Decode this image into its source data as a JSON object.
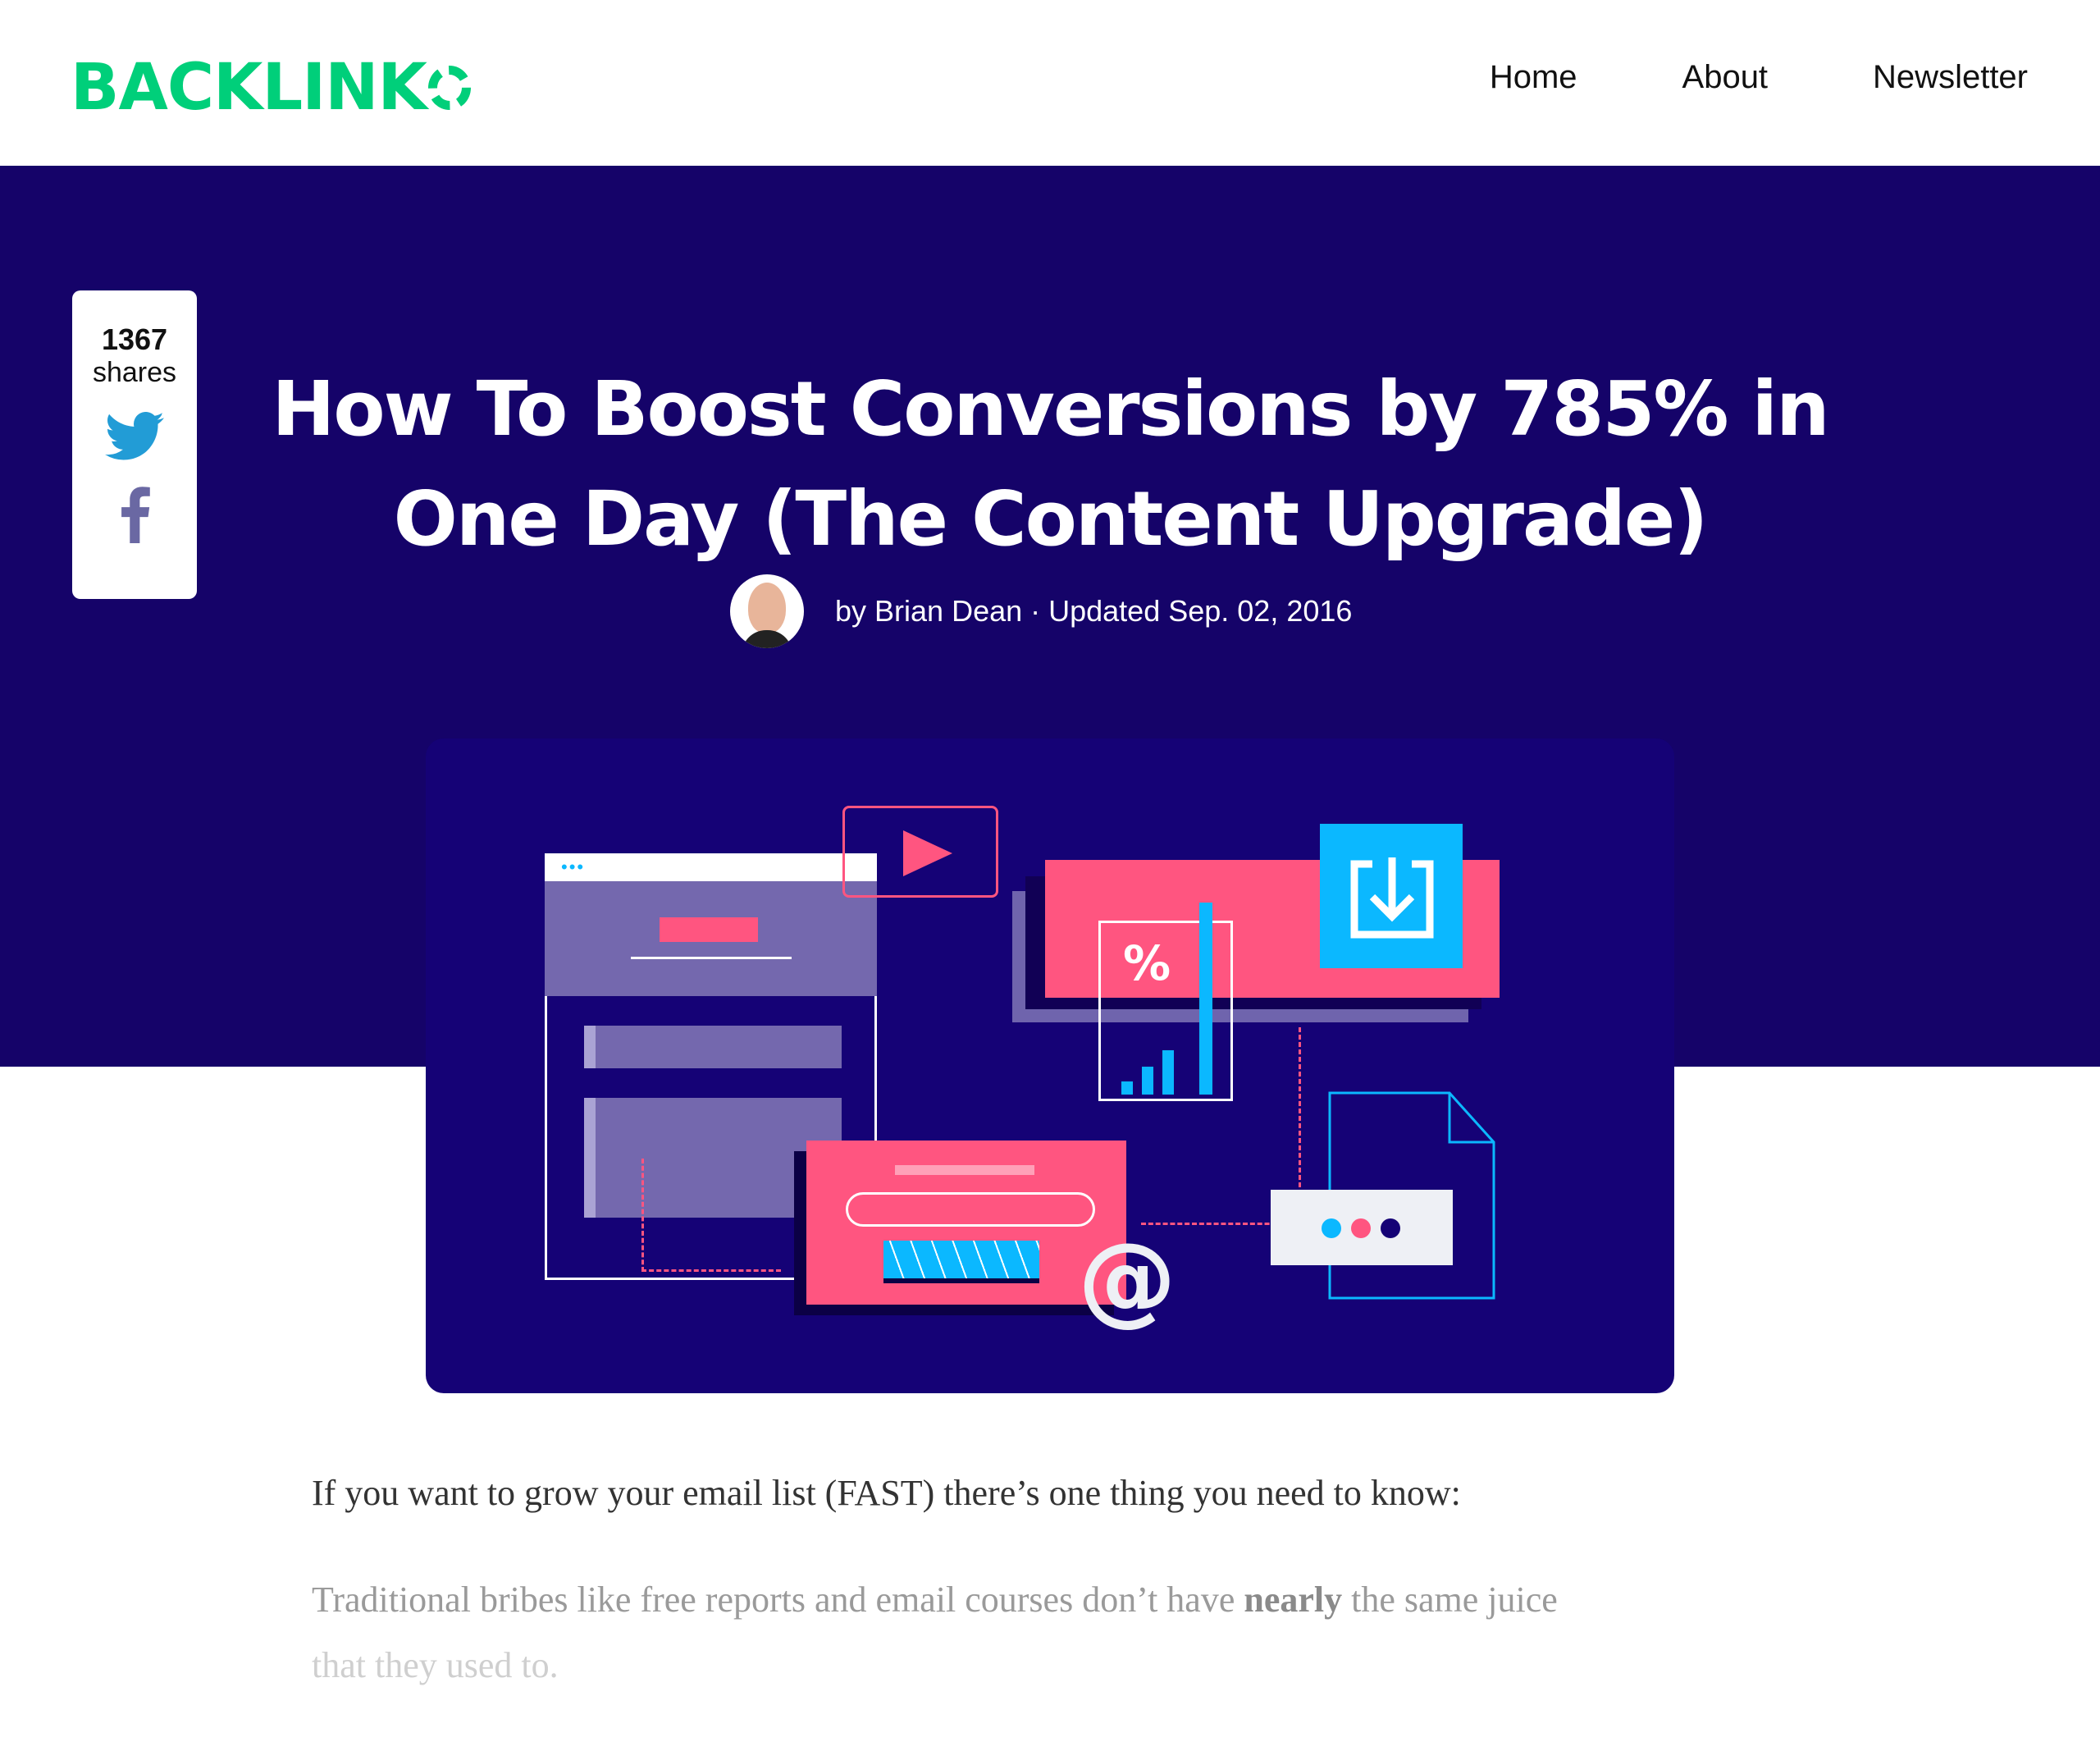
{
  "header": {
    "logo_text": "BACKLINK",
    "nav": [
      {
        "label": "Home"
      },
      {
        "label": "About"
      },
      {
        "label": "Newsletter"
      }
    ]
  },
  "share": {
    "count": "1367",
    "label": "shares",
    "icons": [
      "twitter-icon",
      "facebook-icon"
    ]
  },
  "article": {
    "title": "How To Boost Conversions by 785% in One Day (The Content Upgrade)",
    "byline": "by Brian Dean · Updated Sep. 02, 2016",
    "hero_image_icons": [
      "play-icon",
      "percent-icon",
      "download-icon",
      "at-icon",
      "document-icon"
    ],
    "percent_symbol": "%",
    "at_symbol": "@",
    "paragraph1": "If you want to grow your email list (FAST) there’s one thing you need to know:",
    "paragraph2_before": "Traditional bribes like free reports and email courses don’t have ",
    "paragraph2_bold": "nearly",
    "paragraph2_after": " the same juice",
    "paragraph2_fade": "that they used to."
  },
  "colors": {
    "brand_green": "#00cf7a",
    "hero_bg": "#150369",
    "pink": "#ff5580",
    "cyan": "#0bb8ff",
    "twitter": "#229cd6",
    "facebook": "#6a68a3"
  }
}
